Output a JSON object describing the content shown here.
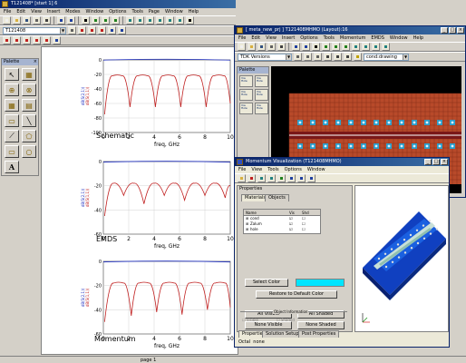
{
  "main": {
    "title": "T121408* [start 1] 6",
    "menu": [
      "File",
      "Edit",
      "View",
      "Insert",
      "Modes",
      "Window",
      "Options",
      "Tools",
      "Page",
      "Window",
      "Help"
    ],
    "design_combo": "T121408",
    "palette_title": "Palette",
    "palette_text_glyph": "A",
    "status_page": "page 1"
  },
  "plots": [
    {
      "label": "Schematic",
      "xlabel": "freq, GHz",
      "ylabels": [
        "dB(S(2,1))",
        "dB(S(1,1))"
      ]
    },
    {
      "label": "EMDS",
      "xlabel": "freq, GHz",
      "ylabels": [
        "dB(S(2,1))",
        "dB(S(1,1))"
      ]
    },
    {
      "label": "Momentum",
      "xlabel": "freq, GHz",
      "ylabels": [
        "dB(S(2,1))",
        "dB(S(1,1))"
      ]
    }
  ],
  "chart_data": [
    {
      "type": "line",
      "title": "",
      "label": "Schematic",
      "xlabel": "freq, GHz",
      "xlim": [
        0,
        10
      ],
      "ylim": [
        -100,
        0
      ],
      "xticks": [
        0,
        2,
        4,
        6,
        8,
        10
      ],
      "yticks": [
        0,
        -20,
        -40,
        -60,
        -80,
        -100
      ],
      "series": [
        {
          "name": "dB(S(2,1))",
          "color": "#2030c0",
          "x": [
            0,
            10
          ],
          "y": [
            -0.3,
            -0.3
          ]
        },
        {
          "name": "dB(S(1,1))",
          "color": "#c02020",
          "x": [
            0.1,
            0.7,
            1.5,
            2.1,
            2.7,
            3.5,
            4.1,
            4.7,
            5.5,
            6.1,
            6.7,
            7.5,
            8.1,
            8.7,
            9.5,
            10
          ],
          "y": [
            -75,
            -22,
            -22,
            -65,
            -22,
            -22,
            -65,
            -22,
            -22,
            -65,
            -22,
            -22,
            -65,
            -22,
            -22,
            -60
          ]
        }
      ]
    },
    {
      "type": "line",
      "title": "",
      "label": "EMDS",
      "xlabel": "freq, GHz",
      "xlim": [
        0,
        10
      ],
      "ylim": [
        -60,
        0
      ],
      "xticks": [
        0,
        2,
        4,
        6,
        8,
        10
      ],
      "yticks": [
        0,
        -20,
        -40,
        -60
      ],
      "series": [
        {
          "name": "dB(S(2,1))",
          "color": "#2030c0",
          "x": [
            0,
            10
          ],
          "y": [
            -0.5,
            -0.5
          ]
        },
        {
          "name": "dB(S(1,1))",
          "color": "#c02020",
          "x": [
            0.1,
            0.8,
            1.6,
            2.4,
            3.2,
            4.0,
            4.8,
            5.6,
            6.4,
            7.2,
            8.0,
            8.8,
            9.6,
            10
          ],
          "y": [
            -45,
            -18,
            -28,
            -18,
            -35,
            -18,
            -28,
            -18,
            -32,
            -18,
            -28,
            -18,
            -30,
            -20
          ]
        }
      ]
    },
    {
      "type": "line",
      "title": "",
      "label": "Momentum",
      "xlabel": "freq, GHz",
      "xlim": [
        0,
        10
      ],
      "ylim": [
        -60,
        0
      ],
      "xticks": [
        0,
        2,
        4,
        6,
        8,
        10
      ],
      "yticks": [
        0,
        -20,
        -40,
        -60
      ],
      "series": [
        {
          "name": "dB(S(2,1))",
          "color": "#2030c0",
          "x": [
            0,
            10
          ],
          "y": [
            -0.5,
            -0.5
          ]
        },
        {
          "name": "dB(S(1,1))",
          "color": "#c02020",
          "x": [
            0.1,
            0.8,
            1.6,
            2.2,
            2.8,
            3.6,
            4.2,
            4.8,
            5.6,
            6.2,
            6.8,
            7.6,
            8.2,
            8.8,
            9.6,
            10
          ],
          "y": [
            -50,
            -18,
            -18,
            -45,
            -18,
            -18,
            -42,
            -18,
            -18,
            -44,
            -18,
            -18,
            -40,
            -18,
            -18,
            -38
          ]
        }
      ]
    }
  ],
  "layout_win": {
    "title": "[ meta_new_prj ] T121408MHMO (Layout):16",
    "menu": [
      "File",
      "Edit",
      "View",
      "Insert",
      "Options",
      "Tools",
      "Momentum",
      "EMDS",
      "Window",
      "Help"
    ],
    "combo": "TDK Versions",
    "layer_combo": "cond:drawing",
    "palette_title": "Palette",
    "palette_items": [
      "Via Hole",
      "Via Hole",
      "Via Hole",
      "Via Hole",
      "Via Hole",
      "Via Hole"
    ]
  },
  "momentum_win": {
    "title": "Momentum Visualization (T121408MHMO)",
    "menu": [
      "File",
      "View",
      "Tools",
      "Options",
      "Window"
    ],
    "properties_title": "Properties",
    "tabs": [
      "Materials",
      "Objects"
    ],
    "table_headers": [
      "Name",
      "Vis",
      "Shd"
    ],
    "table_rows": [
      "cond",
      "Zalum",
      "hole"
    ],
    "buttons": {
      "select_color": "Select Color",
      "restore": "Restore to Default Color",
      "all_visible": "All Visible",
      "all_shaded": "All Shaded",
      "none_visible": "None Visible",
      "none_shaded": "None Shaded"
    },
    "object_info": "Object Information",
    "chk_visible": "Visible",
    "chk_shaded": "Shaded",
    "bottom_tabs": [
      "Properties",
      "Solution Setup",
      "Post Properties"
    ],
    "freq_label": "Octal",
    "freq_value": " none"
  },
  "colors": {
    "accent": "#0a246a",
    "s11": "#c02020",
    "s21": "#2030c0",
    "cyan": "#00e5ff"
  }
}
